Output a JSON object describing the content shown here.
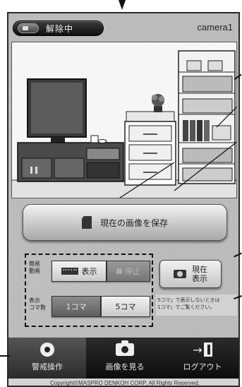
{
  "header": {
    "status_label": "解除中",
    "camera_name": "camera1"
  },
  "actions": {
    "save_image_label": "現在の画像を保存",
    "current_display_line1": "現在",
    "current_display_line2": "表示"
  },
  "simple_video": {
    "label_line1": "簡易",
    "label_line2": "動画",
    "show_label": "表示",
    "stop_label": "停止"
  },
  "frame_count": {
    "label_line1": "表示",
    "label_line2": "コマ数",
    "one_frame": "1コマ",
    "five_frames": "5コマ"
  },
  "hint": {
    "line1": "5コマ」で表示しないときは",
    "line2": "1コマ」でご覧ください。"
  },
  "tabs": [
    {
      "label": "警戒操作",
      "icon": "eye-icon"
    },
    {
      "label": "画像を見る",
      "icon": "camera-icon"
    },
    {
      "label": "ログアウト",
      "icon": "logout-icon"
    }
  ],
  "footer": {
    "copyright": "Copyright©MASPRO DENKOH CORP. All Rights Reserved."
  }
}
